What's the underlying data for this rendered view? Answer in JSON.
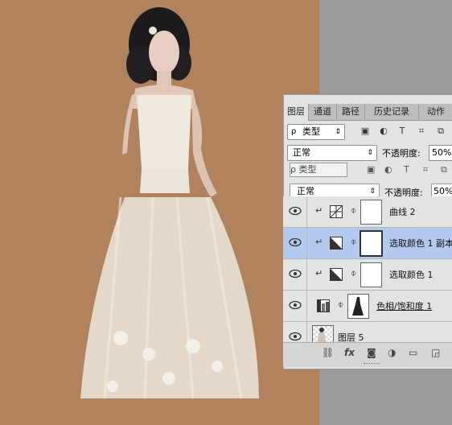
{
  "panel": {
    "tabs": [
      "图层",
      "通道",
      "路径",
      "历史记录",
      "动作"
    ],
    "active_tab": "图层",
    "filter": {
      "label": "类型",
      "glyph": "ρ"
    },
    "blend_mode": "正常",
    "opacity_label": "不透明度:",
    "opacity_value": "50%"
  },
  "ghost_header": {
    "filter_label": "ρ 类型",
    "blend_mode": "正常",
    "opacity_label": "不透明度:",
    "opacity_value": "50%"
  },
  "layers": [
    {
      "name": "曲线 2",
      "type": "curves",
      "clipped": true,
      "selected": false
    },
    {
      "name": "选取颜色 1 副本",
      "type": "selective-color",
      "clipped": true,
      "selected": true
    },
    {
      "name": "选取颜色 1",
      "type": "selective-color",
      "clipped": true,
      "selected": false
    },
    {
      "name": "色相/饱和度 1",
      "type": "hue-saturation",
      "clipped": false,
      "selected": false
    },
    {
      "name": "图层 5",
      "type": "pixel",
      "clipped": false,
      "selected": false
    }
  ],
  "footer_icons": [
    "link-icon",
    "fx-icon",
    "add-mask-icon",
    "adjustment-icon",
    "folder-icon",
    "new-layer-icon"
  ],
  "colors": {
    "canvas_bg": "#b0825d",
    "selected_row": "#b4c9ee",
    "panel_bg": "#e3e3e3"
  }
}
